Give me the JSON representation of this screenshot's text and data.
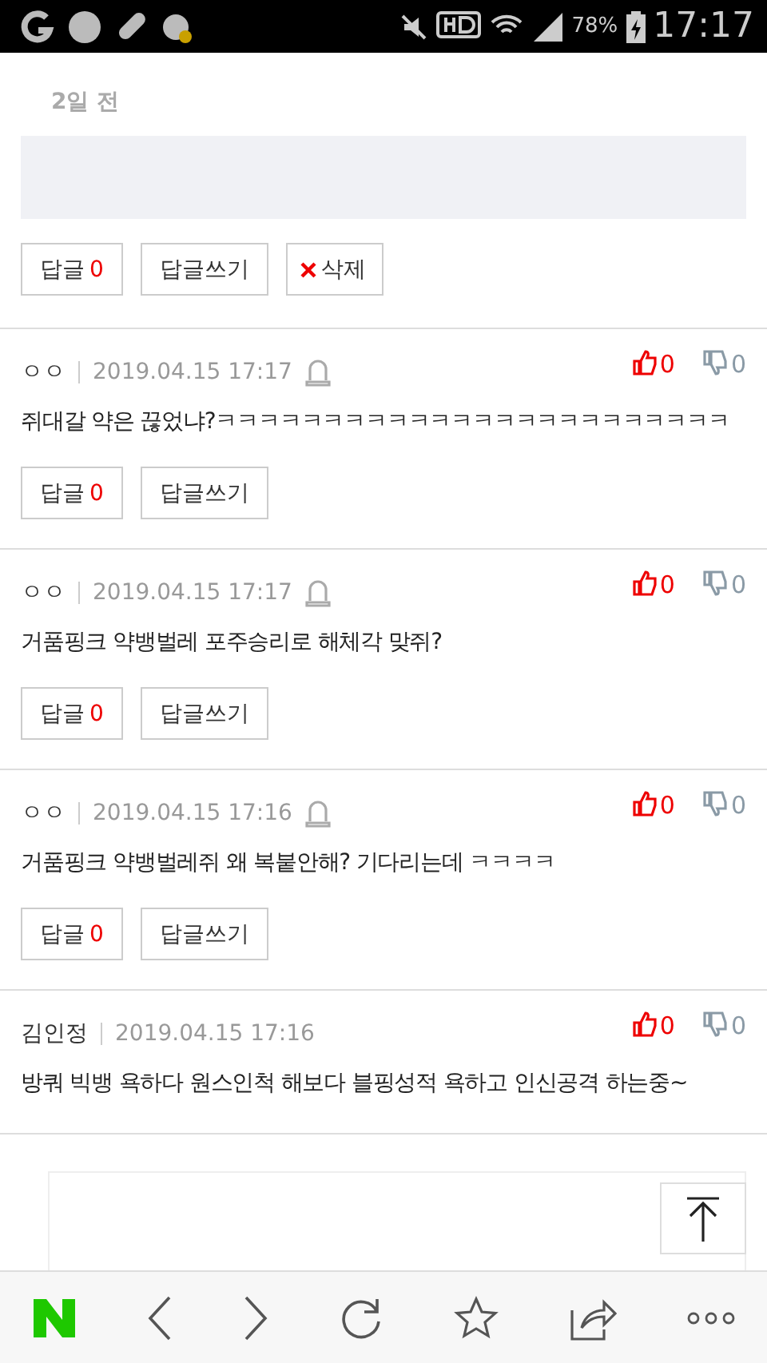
{
  "status_bar": {
    "battery": "78%",
    "time": "17:17"
  },
  "top_comment": {
    "time_ago": "2일 전",
    "reply_label": "답글",
    "reply_count": "0",
    "write_label": "답글쓰기",
    "delete_label": "삭제"
  },
  "comments": [
    {
      "author": "ㅇㅇ",
      "date": "2019.04.15 17:17",
      "reportable": true,
      "likes": "0",
      "dislikes": "0",
      "text": "쥐대갈 약은 끊었냐?ㅋㅋㅋㅋㅋㅋㅋㅋㅋㅋㅋㅋㅋㅋㅋㅋㅋㅋㅋㅋㅋㅋㅋㅋ",
      "reply_label": "답글",
      "reply_count": "0",
      "write_label": "답글쓰기"
    },
    {
      "author": "ㅇㅇ",
      "date": "2019.04.15 17:17",
      "reportable": true,
      "likes": "0",
      "dislikes": "0",
      "text": "거품핑크 약뱅벌레 포주승리로 해체각 맞쥐?",
      "reply_label": "답글",
      "reply_count": "0",
      "write_label": "답글쓰기"
    },
    {
      "author": "ㅇㅇ",
      "date": "2019.04.15 17:16",
      "reportable": true,
      "likes": "0",
      "dislikes": "0",
      "text": "거품핑크 약뱅벌레쥐 왜 복붙안해? 기다리는데 ㅋㅋㅋㅋ",
      "reply_label": "답글",
      "reply_count": "0",
      "write_label": "답글쓰기"
    },
    {
      "author": "김인정",
      "date": "2019.04.15 17:16",
      "reportable": false,
      "likes": "0",
      "dislikes": "0",
      "text": "방쿼 빅뱅 욕하다 원스인척 해보다 블핑성적 욕하고 인신공격 하는중~"
    }
  ]
}
